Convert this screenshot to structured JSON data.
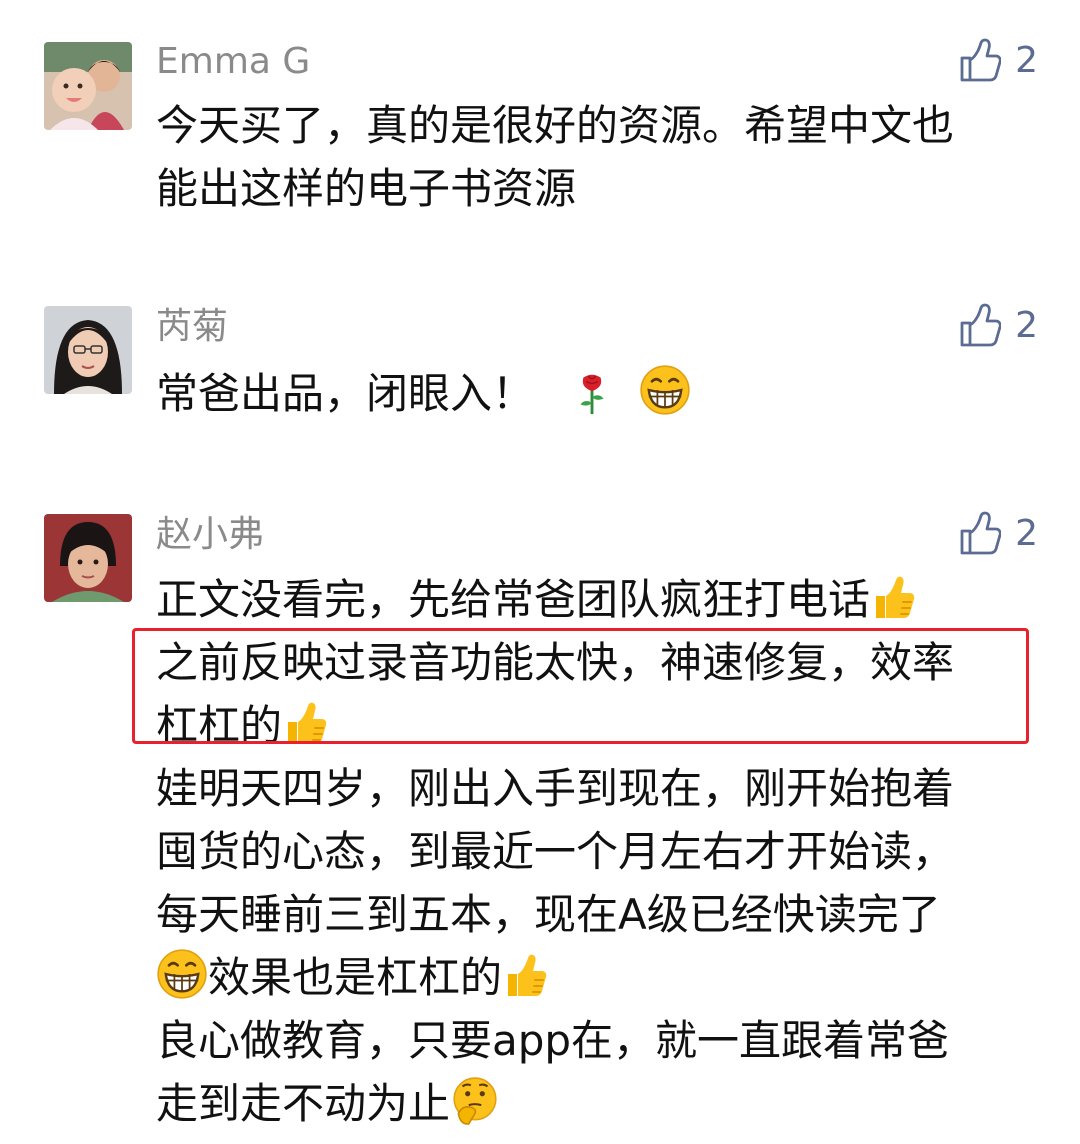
{
  "comments": [
    {
      "name": "Emma G",
      "likes": "2",
      "lines": [
        "今天买了，真的是很好的资源。希望中文也",
        "能出这样的电子书资源"
      ]
    },
    {
      "name": "芮菊",
      "likes": "2",
      "lines": [
        "常爸出品，闭眼入！"
      ],
      "emojis": [
        "rose-emoji",
        "grin-emoji"
      ]
    },
    {
      "name": "赵小弗",
      "likes": "2",
      "lines": [
        "正文没看完，先给常爸团队疯狂打电话",
        "之前反映过录音功能太快，神速修复，效率",
        "杠杠的",
        "娃明天四岁，刚出入手到现在，刚开始抱着",
        "囤货的心态，到最近一个月左右才开始读，",
        "每天睡前三到五本，现在A级已经快读完了",
        "效果也是杠杠的",
        "良心做教育，只要app在，就一直跟着常爸",
        "走到走不动为止"
      ]
    }
  ],
  "colors": {
    "name": "#8a8a8a",
    "like": "#5b6b92",
    "highlight": "#e8212c"
  },
  "icons": [
    "thumbs-up-outline-icon",
    "thumbs-up-emoji",
    "grin-emoji",
    "rose-emoji",
    "hmm-emoji"
  ]
}
